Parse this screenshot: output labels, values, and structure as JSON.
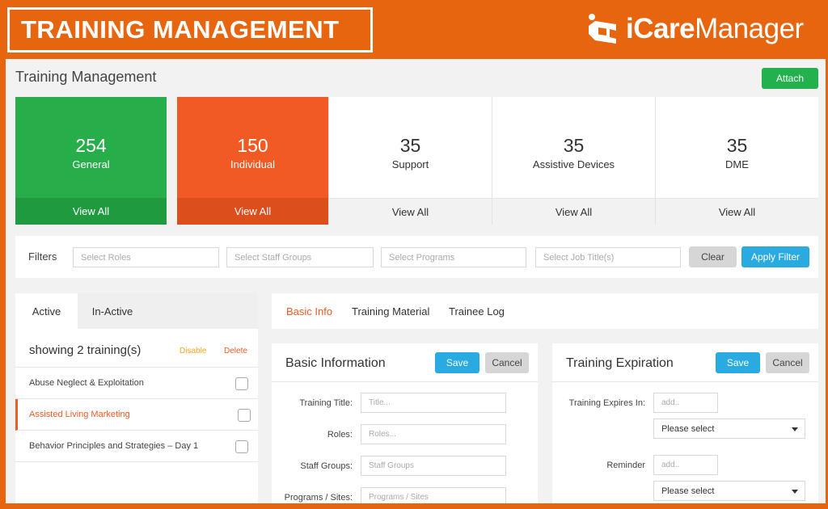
{
  "banner": {
    "title": "TRAINING MANAGEMENT",
    "brand_prefix": "iCare",
    "brand_suffix": "Manager",
    "logo_icon": "icaremanager-logo-icon"
  },
  "page": {
    "title": "Training Management",
    "attach_label": "Attach"
  },
  "cards": [
    {
      "count": "254",
      "label": "General",
      "link": "View All",
      "color": "#27ae4a"
    },
    {
      "count": "150",
      "label": "Individual",
      "link": "View All",
      "color": "#f15a24"
    },
    {
      "count": "35",
      "label": "Support",
      "link": "View All"
    },
    {
      "count": "35",
      "label": "Assistive Devices",
      "link": "View All"
    },
    {
      "count": "35",
      "label": "DME",
      "link": "View All"
    }
  ],
  "filters": {
    "label": "Filters",
    "roles_placeholder": "Select Roles",
    "staff_groups_placeholder": "Select Staff Groups",
    "programs_placeholder": "Select Programs",
    "job_title_placeholder": "Select Job Title(s)",
    "clear_label": "Clear",
    "apply_label": "Apply Filter"
  },
  "left_panel": {
    "tabs": [
      "Active",
      "In-Active"
    ],
    "showing": "showing 2 training(s)",
    "disable_label": "Disable",
    "delete_label": "Delete",
    "trainings": [
      "Abuse Neglect & Exploitation",
      "Assisted Living Marketing",
      "Behavior Principles and Strategies – Day 1"
    ]
  },
  "detail_tabs": [
    "Basic Info",
    "Training Material",
    "Trainee Log"
  ],
  "basic_info": {
    "title": "Basic Information",
    "save_label": "Save",
    "cancel_label": "Cancel",
    "fields": [
      {
        "label": "Training Title:",
        "placeholder": "Title..."
      },
      {
        "label": "Roles:",
        "placeholder": "Roles..."
      },
      {
        "label": "Staff Groups:",
        "placeholder": "Staff Groups"
      },
      {
        "label": "Programs / Sites:",
        "placeholder": "Programs / Sites"
      }
    ]
  },
  "expiration": {
    "title": "Training Expiration",
    "save_label": "Save",
    "cancel_label": "Cancel",
    "expires_label": "Training Expires In:",
    "expires_placeholder": "add..",
    "expires_unit": "Please select",
    "reminder_label": "Reminder",
    "reminder_placeholder": "add..",
    "reminder_unit": "Please select"
  },
  "colors": {
    "banner": "#e8650f",
    "green": "#27ae4a",
    "orange": "#f15a24",
    "blue": "#29abe2"
  }
}
